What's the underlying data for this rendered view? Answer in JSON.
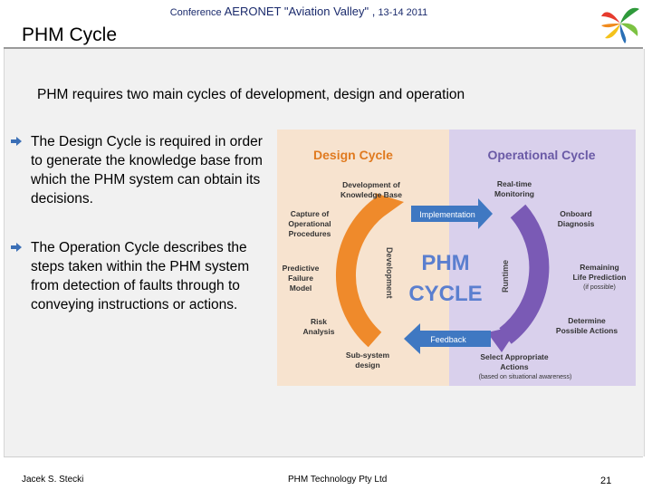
{
  "header": {
    "conference_prefix": "Conference",
    "conference_name": "AERONET \"Aviation Valley\" ,",
    "conference_dates": "13-14 2011",
    "title": "PHM Cycle"
  },
  "content": {
    "intro": "PHM requires two main cycles of development, design and operation",
    "bullets": [
      "The Design Cycle is required  in order to generate the knowledge base from which the PHM system can obtain its decisions.",
      "The Operation Cycle describes the steps taken within the PHM system from detection of faults through to conveying instructions or actions."
    ]
  },
  "diagram": {
    "design_title": "Design Cycle",
    "operational_title": "Operational Cycle",
    "center_line1": "PHM",
    "center_line2": "CYCLE",
    "implementation": "Implementation",
    "feedback": "Feedback",
    "development": "Development",
    "runtime": "Runtime",
    "labels": {
      "dev_kb_1": "Development of",
      "dev_kb_2": "Knowledge Base",
      "capture_1": "Capture of",
      "capture_2": "Operational",
      "capture_3": "Procedures",
      "pfm_1": "Predictive",
      "pfm_2": "Failure",
      "pfm_3": "Model",
      "risk_1": "Risk",
      "risk_2": "Analysis",
      "subsys_1": "Sub-system",
      "subsys_2": "design",
      "rt_1": "Real-time",
      "rt_2": "Monitoring",
      "onboard_1": "Onboard",
      "onboard_2": "Diagnosis",
      "rul_1": "Remaining",
      "rul_2": "Life Prediction",
      "rul_3": "(if possible)",
      "det_1": "Determine",
      "det_2": "Possible Actions",
      "sel_1": "Select Appropriate",
      "sel_2": "Actions",
      "sel_3": "(based on situational awareness)"
    },
    "colors": {
      "design_bg": "#f7e3cf",
      "operational_bg": "#d9d0ec",
      "orange": "#ef8a2b",
      "purple": "#7a5ab5",
      "blue": "#3f78c2"
    }
  },
  "footer": {
    "author": "Jacek S. Stecki",
    "company": "PHM Technology Pty Ltd",
    "page": "21"
  }
}
